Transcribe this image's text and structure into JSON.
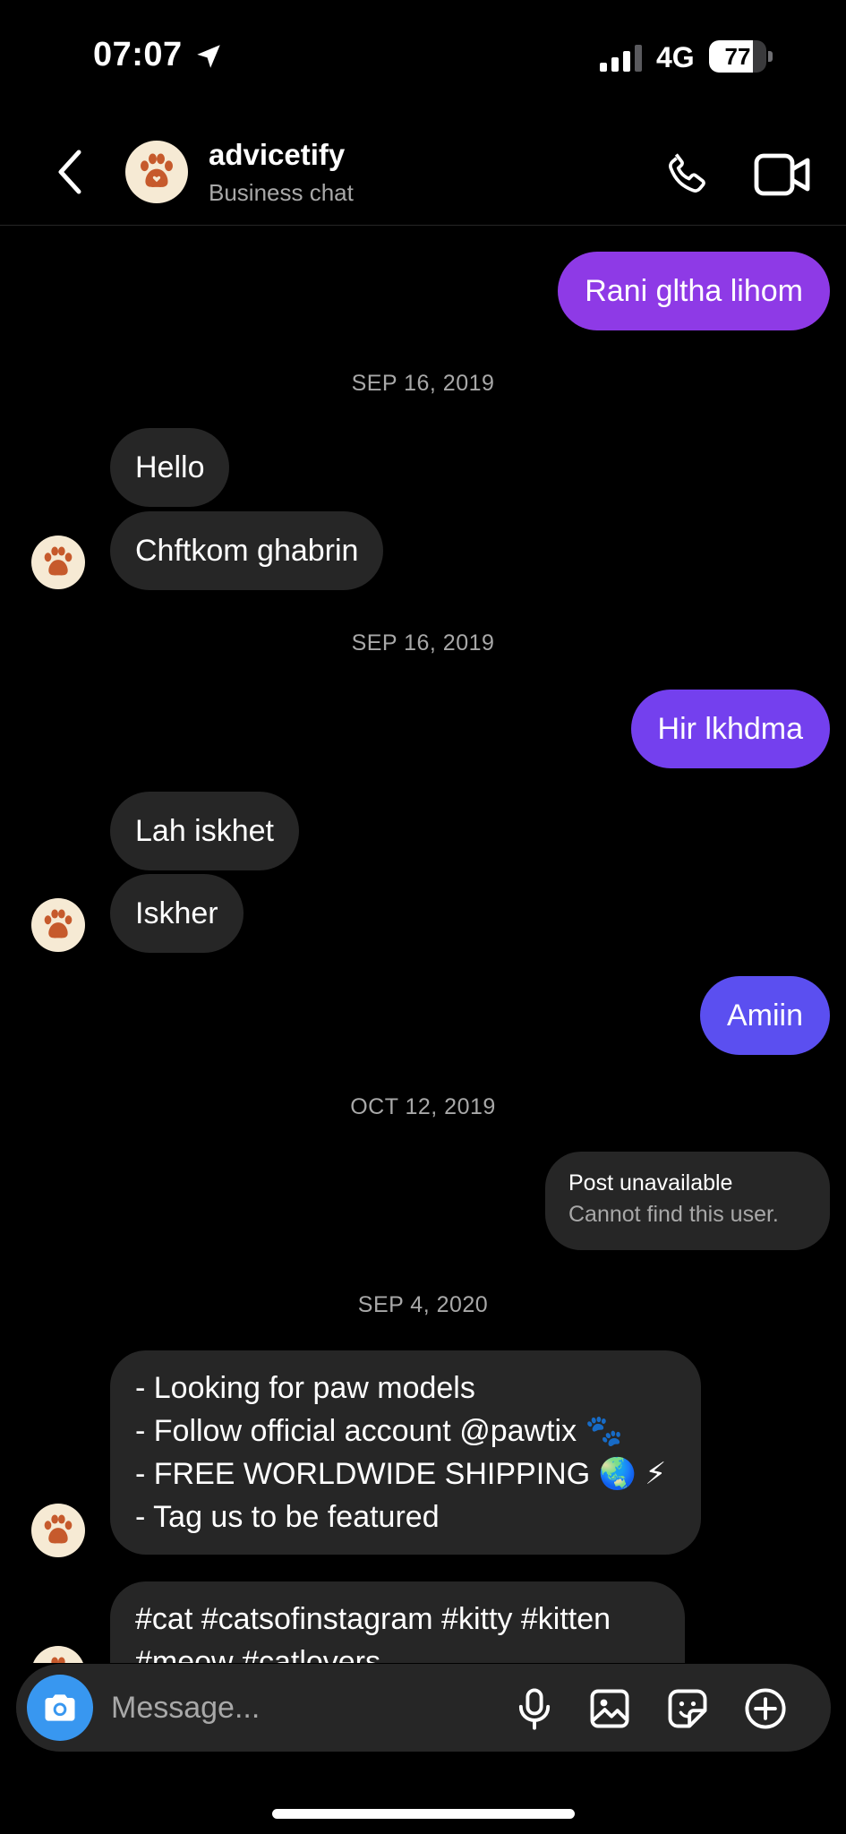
{
  "status_bar": {
    "time": "07:07",
    "network": "4G",
    "battery": "77",
    "battery_level": 0.77
  },
  "header": {
    "name": "advicetify",
    "subtitle": "Business chat"
  },
  "messages": {
    "out1": "Rani gltha lihom",
    "date1": "SEP 16, 2019",
    "in1": "Hello",
    "in2": "Chftkom ghabrin",
    "date2": "SEP 16, 2019",
    "out2": "Hir lkhdma",
    "in3": "Lah iskhet",
    "in4": "Iskher",
    "out3": "Amiin",
    "date3": "OCT 12, 2019",
    "unavailable_title": "Post unavailable",
    "unavailable_sub": "Cannot find this user.",
    "date4": "SEP 4, 2020",
    "promo_lines": [
      "- Looking for paw models",
      "- Follow official account @pawtix 🐾",
      "- FREE WORLDWIDE SHIPPING 🌏 ⚡",
      "- Tag us to be featured"
    ],
    "hashtags": "#cat #catsofinstagram #kitty #kitten #meow #catlovers"
  },
  "composer": {
    "placeholder": "Message..."
  },
  "colors": {
    "out1": "#8e3ae6",
    "out2": "#7440ee",
    "out3": "#5b4ff0",
    "incoming": "#262626",
    "camera": "#3897f0",
    "avatar_bg": "#f6ead4",
    "paw": "#c65a2c"
  },
  "icons": {
    "back": "chevron-left-icon",
    "call": "phone-icon",
    "video": "video-camera-icon",
    "camera": "camera-icon",
    "mic": "microphone-icon",
    "gallery": "image-icon",
    "sticker": "sticker-icon",
    "more": "plus-circle-icon",
    "avatar": "paw-icon"
  }
}
